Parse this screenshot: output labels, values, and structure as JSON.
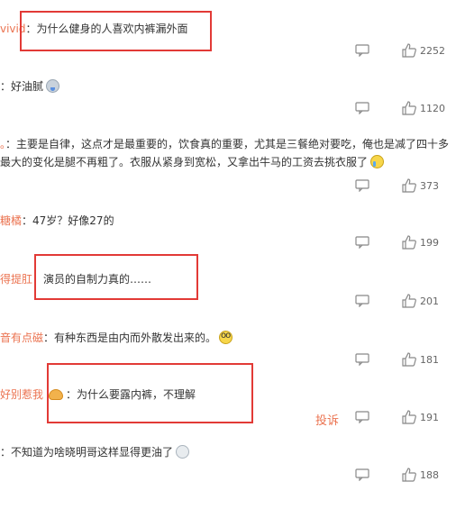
{
  "comments": [
    {
      "user": "vivid",
      "text": "为什么健身的人喜欢内裤漏外面",
      "likes": "2252"
    },
    {
      "user": "",
      "text": "好油腻",
      "likes": "1120",
      "emoji": "drool-emoji-icon"
    },
    {
      "user": "",
      "text": "主要是自律，这点才是最重要的，饮食真的重要，尤其是三餐绝对要吃，俺也是减了四十多",
      "text2": "最大的变化是腿不再粗了。衣服从紧身到宽松，又拿出牛马的工资去挑衣服了",
      "likes": "373",
      "emoji": "cry-emoji-icon"
    },
    {
      "user": "糖橘",
      "text": "47岁？好像27的",
      "likes": "199"
    },
    {
      "user": "得提肛",
      "text": "演员的自制力真的……",
      "likes": "201"
    },
    {
      "user": "音有点磁",
      "text": "有种东西是由内而外散发出来的。",
      "likes": "181",
      "emoji": "glasses-emoji-icon"
    },
    {
      "user": "好别惹我",
      "text": "为什么要露内裤，不理解",
      "likes": "191",
      "report_label": "投诉"
    },
    {
      "user": "",
      "text": "不知道为啥晓明哥这样显得更油了",
      "likes": "188",
      "emoji": "sick-emoji-icon"
    }
  ],
  "colors": {
    "username": "#eb7350",
    "text": "#333333",
    "highlight_box": "#e23a36",
    "report": "#eb7350"
  }
}
